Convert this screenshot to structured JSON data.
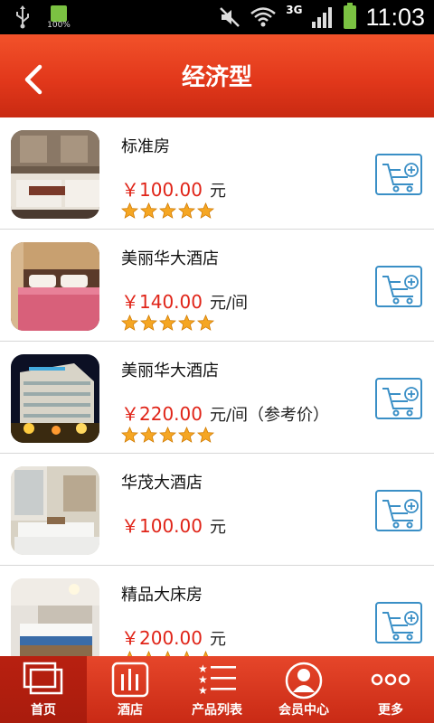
{
  "status_bar": {
    "battery_percent_label": "100%",
    "network_label": "3G",
    "time": "11:03"
  },
  "header": {
    "title": "经济型"
  },
  "items": [
    {
      "name": "标准房",
      "price": "￥100.00",
      "unit": "元",
      "stars": 5
    },
    {
      "name": "美丽华大酒店",
      "price": "￥140.00",
      "unit": "元/间",
      "stars": 5
    },
    {
      "name": "美丽华大酒店",
      "price": "￥220.00",
      "unit": "元/间（参考价）",
      "stars": 5
    },
    {
      "name": "华茂大酒店",
      "price": "￥100.00",
      "unit": "元",
      "stars": 0
    },
    {
      "name": "精品大床房",
      "price": "￥200.00",
      "unit": "元",
      "stars": 5
    }
  ],
  "tabs": [
    {
      "label": "首页",
      "icon": "home-windows-icon",
      "active": true
    },
    {
      "label": "酒店",
      "icon": "hotel-bars-icon",
      "active": false
    },
    {
      "label": "产品列表",
      "icon": "star-list-icon",
      "active": false
    },
    {
      "label": "会员中心",
      "icon": "member-avatar-icon",
      "active": false
    },
    {
      "label": "更多",
      "icon": "more-dots-icon",
      "active": false
    }
  ],
  "colors": {
    "header_red": "#e2381b",
    "price_red": "#e02418",
    "cart_blue": "#3a8fc6",
    "star_orange": "#f5a623"
  }
}
